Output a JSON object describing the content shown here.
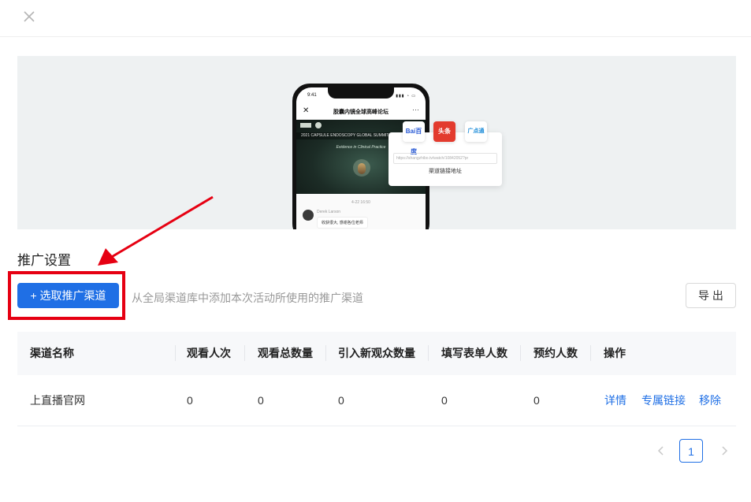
{
  "colors": {
    "primary": "#1f6fe5",
    "highlight": "#e60012",
    "hero_bg": "#eef1f2"
  },
  "icons": {
    "close": "close-icon",
    "prev": "chevron-left-icon",
    "next": "chevron-right-icon"
  },
  "preview": {
    "status_time": "9:41",
    "page_title": "胶囊内镜全球高峰论坛",
    "banner_strip": "2021 CAPSULE ENDOSCOPY GLOBAL SUMMIT",
    "banner_subtitle": "Evidence in Clinical Practice",
    "chat_time": "4-22 16:50",
    "chat_name": "Derek Larson",
    "chat_message": "收获很大, 感谢各位老师",
    "channel_icons": [
      "Bai百度",
      "头条",
      "广点通"
    ],
    "url": "https://shangzhibo.tv/watch/10842052?pr",
    "url_label": "渠道链接地址"
  },
  "section": {
    "title": "推广设置"
  },
  "toolbar": {
    "select_label": "+ 选取推广渠道",
    "hint": "从全局渠道库中添加本次活动所使用的推广渠道",
    "export_label": "导 出"
  },
  "table": {
    "headers": [
      "渠道名称",
      "观看人次",
      "观看总数量",
      "引入新观众数量",
      "填写表单人数",
      "预约人数",
      "操作"
    ],
    "rows": [
      {
        "name": "上直播官网",
        "views": "0",
        "total": "0",
        "new_viewers": "0",
        "forms": "0",
        "reservations": "0",
        "actions": [
          "详情",
          "专属链接",
          "移除"
        ]
      }
    ]
  },
  "pagination": {
    "current": "1"
  }
}
